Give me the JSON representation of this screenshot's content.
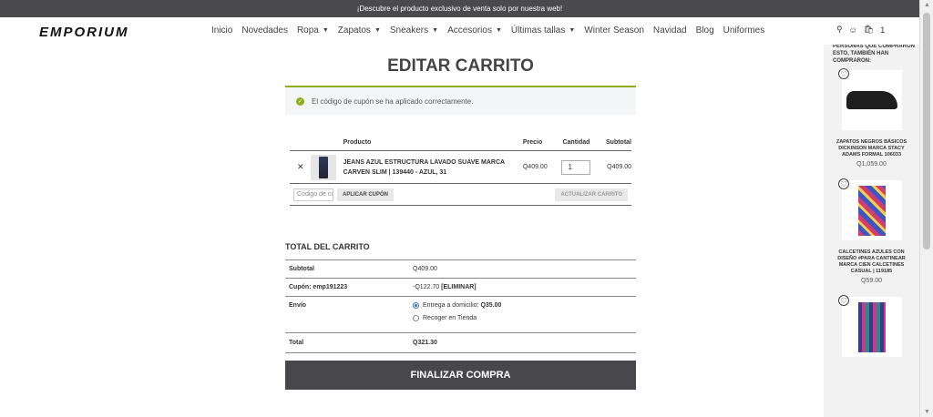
{
  "announcement": "¡Descubre el producto exclusivo de venta solo por nuestra web!",
  "brand": "EMPORIUM",
  "nav": [
    "Inicio",
    "Novedades",
    "Ropa",
    "Zapatos",
    "Sneakers",
    "Accesorios",
    "Últimas tallas",
    "Winter Season",
    "Navidad",
    "Blog",
    "Uniformes"
  ],
  "nav_dropdown": [
    false,
    false,
    true,
    true,
    true,
    true,
    true,
    false,
    false,
    false,
    false
  ],
  "cart_count": "1",
  "page_title": "EDITAR CARRITO",
  "notice": "El código de cupón se ha aplicado correctamente.",
  "cart": {
    "headers": {
      "product": "Producto",
      "price": "Precio",
      "qty": "Cantidad",
      "subtotal": "Subtotal"
    },
    "item": {
      "name": "JEANS AZUL ESTRUCTURA LAVADO SUAVE MARCA CARVEN SLIM | 139440 - AZUL, 31",
      "price": "Q409.00",
      "qty": "1",
      "subtotal": "Q409.00"
    },
    "coupon_placeholder": "Código de cupón",
    "apply_label": "APLICAR CUPÓN",
    "update_label": "ACTUALIZAR CARRITO"
  },
  "totals": {
    "title": "TOTAL DEL CARRITO",
    "subtotal_label": "Subtotal",
    "subtotal": "Q409.00",
    "coupon_label": "Cupón: emp191223",
    "coupon_value": "-Q122.70",
    "coupon_remove": "[ELIMINAR]",
    "shipping_label": "Envío",
    "ship_home": "Entrega a domicilio:",
    "ship_home_price": "Q35.00",
    "ship_pickup": "Recoger en Tienda",
    "total_label": "Total",
    "total": "Q321.30"
  },
  "checkout_label": "FINALIZAR COMPRA",
  "sidebar": {
    "title": "PERSONAS QUE COMPRARON ESTO, TAMBIÉN HAN COMPRARON:",
    "products": [
      {
        "name": "ZAPATOS NEGROS BÁSICOS DICKINSON MARCA STACY ADAMS FORMAL 106033",
        "price": "Q1,059.00"
      },
      {
        "name": "CALCETINES AZULES CON DISEÑO #PARA CANTINEAR MARCA CIEN CALCETINES CASUAL | 119185",
        "price": "Q59.00"
      }
    ]
  }
}
